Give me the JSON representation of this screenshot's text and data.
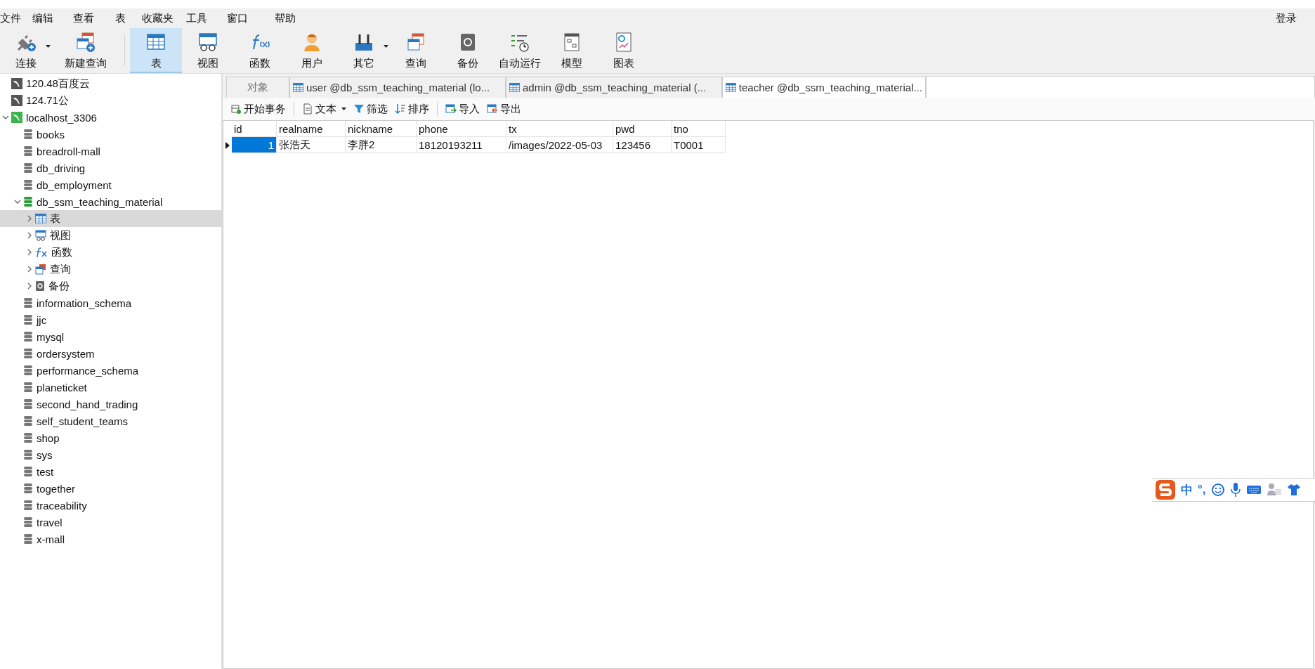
{
  "menu": {
    "items": [
      "文件",
      "编辑",
      "查看",
      "表",
      "收藏夹",
      "工具",
      "窗口",
      "帮助"
    ],
    "login": "登录"
  },
  "toolbar": [
    {
      "kind": "connect",
      "label": "连接",
      "dropdown": true,
      "selected": false
    },
    {
      "kind": "newquery",
      "label": "新建查询",
      "dropdown": false,
      "selected": false
    },
    {
      "kind": "table",
      "label": "表",
      "dropdown": false,
      "selected": true
    },
    {
      "kind": "view",
      "label": "视图",
      "dropdown": false,
      "selected": false
    },
    {
      "kind": "function",
      "label": "函数",
      "dropdown": false,
      "selected": false
    },
    {
      "kind": "user",
      "label": "用户",
      "dropdown": false,
      "selected": false
    },
    {
      "kind": "other",
      "label": "其它",
      "dropdown": true,
      "selected": false
    },
    {
      "kind": "query",
      "label": "查询",
      "dropdown": false,
      "selected": false
    },
    {
      "kind": "backup",
      "label": "备份",
      "dropdown": false,
      "selected": false
    },
    {
      "kind": "autorun",
      "label": "自动运行",
      "dropdown": false,
      "selected": false
    },
    {
      "kind": "model",
      "label": "模型",
      "dropdown": false,
      "selected": false
    },
    {
      "kind": "chart",
      "label": "图表",
      "dropdown": false,
      "selected": false
    }
  ],
  "sidebar": {
    "items": [
      {
        "kind": "connection",
        "label": "120.48百度云",
        "open": false
      },
      {
        "kind": "connection",
        "label": "124.71公",
        "open": false
      },
      {
        "kind": "connection",
        "label": "localhost_3306",
        "open": true,
        "expanded": true,
        "children": [
          {
            "kind": "database",
            "label": "books",
            "open": false
          },
          {
            "kind": "database",
            "label": "breadroll-mall",
            "open": false
          },
          {
            "kind": "database",
            "label": "db_driving",
            "open": false
          },
          {
            "kind": "database",
            "label": "db_employment",
            "open": false
          },
          {
            "kind": "database",
            "label": "db_ssm_teaching_material",
            "open": true,
            "expanded": true,
            "children": [
              {
                "kind": "table",
                "label": "表",
                "expanded": false,
                "selected": true
              },
              {
                "kind": "view",
                "label": "视图",
                "expanded": false,
                "selected": false
              },
              {
                "kind": "function",
                "label": "函数",
                "expanded": false,
                "selected": false
              },
              {
                "kind": "query",
                "label": "查询",
                "expanded": false,
                "selected": false
              },
              {
                "kind": "backup",
                "label": "备份",
                "expanded": false,
                "selected": false
              }
            ]
          },
          {
            "kind": "database",
            "label": "information_schema",
            "open": false
          },
          {
            "kind": "database",
            "label": "jjc",
            "open": false
          },
          {
            "kind": "database",
            "label": "mysql",
            "open": false
          },
          {
            "kind": "database",
            "label": "ordersystem",
            "open": false
          },
          {
            "kind": "database",
            "label": "performance_schema",
            "open": false
          },
          {
            "kind": "database",
            "label": "planeticket",
            "open": false
          },
          {
            "kind": "database",
            "label": "second_hand_trading",
            "open": false
          },
          {
            "kind": "database",
            "label": "self_student_teams",
            "open": false
          },
          {
            "kind": "database",
            "label": "shop",
            "open": false
          },
          {
            "kind": "database",
            "label": "sys",
            "open": false
          },
          {
            "kind": "database",
            "label": "test",
            "open": false
          },
          {
            "kind": "database",
            "label": "together",
            "open": false
          },
          {
            "kind": "database",
            "label": "traceability",
            "open": false
          },
          {
            "kind": "database",
            "label": "travel",
            "open": false
          },
          {
            "kind": "database",
            "label": "x-mall",
            "open": false
          }
        ]
      }
    ]
  },
  "tabs": [
    {
      "kind": "objects",
      "label": "对象",
      "selected": false
    },
    {
      "kind": "table",
      "label": "user @db_ssm_teaching_material (lo...",
      "selected": false
    },
    {
      "kind": "table",
      "label": "admin @db_ssm_teaching_material (...",
      "selected": false
    },
    {
      "kind": "table",
      "label": "teacher @db_ssm_teaching_material...",
      "selected": true
    }
  ],
  "grid_toolbar": [
    {
      "kind": "transaction",
      "label": "开始事务",
      "dropdown": false
    },
    {
      "kind": "text",
      "label": "文本",
      "dropdown": true
    },
    {
      "kind": "filter",
      "label": "筛选",
      "dropdown": false
    },
    {
      "kind": "sort",
      "label": "排序",
      "dropdown": false
    },
    {
      "kind": "import",
      "label": "导入",
      "dropdown": false
    },
    {
      "kind": "export",
      "label": "导出",
      "dropdown": false
    }
  ],
  "table": {
    "columns": [
      "id",
      "realname",
      "nickname",
      "phone",
      "tx",
      "pwd",
      "tno"
    ],
    "rows": [
      {
        "current": true,
        "cells": [
          {
            "text": "1",
            "selected": true
          },
          {
            "text": "张浩天",
            "selected": false
          },
          {
            "text": "李胖2",
            "selected": false
          },
          {
            "text": "18120193211",
            "selected": false
          },
          {
            "text": "/images/2022-05-03",
            "selected": false
          },
          {
            "text": "123456",
            "selected": false
          },
          {
            "text": "T0001",
            "selected": false
          }
        ]
      }
    ]
  },
  "ime_bar": {
    "texts": [
      "中",
      "°,"
    ]
  }
}
